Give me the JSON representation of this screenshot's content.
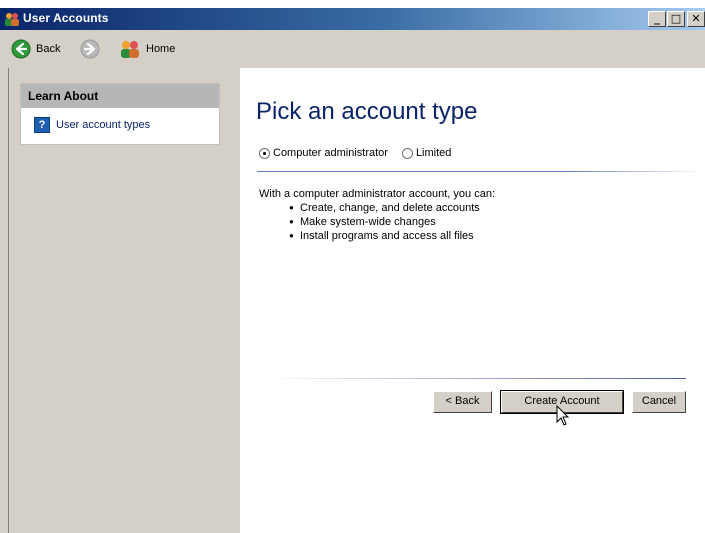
{
  "window": {
    "title": "User Accounts"
  },
  "nav": {
    "back_label": "Back",
    "home_label": "Home"
  },
  "sidebar": {
    "header": "Learn About",
    "links": [
      {
        "label": "User account types"
      }
    ]
  },
  "main": {
    "title": "Pick an account type",
    "radio_options": [
      {
        "label": "Computer administrator",
        "checked": true
      },
      {
        "label": "Limited",
        "checked": false
      }
    ],
    "description": "With a computer administrator account, you can:",
    "bullets": [
      "Create, change, and delete accounts",
      "Make system-wide changes",
      "Install programs and access all files"
    ],
    "buttons": {
      "back": "< Back",
      "create": "Create Account",
      "cancel": "Cancel"
    }
  },
  "colors": {
    "title_bar": "#0a246a",
    "page_title": "#0a246a",
    "panel": "#d4d0c8"
  }
}
